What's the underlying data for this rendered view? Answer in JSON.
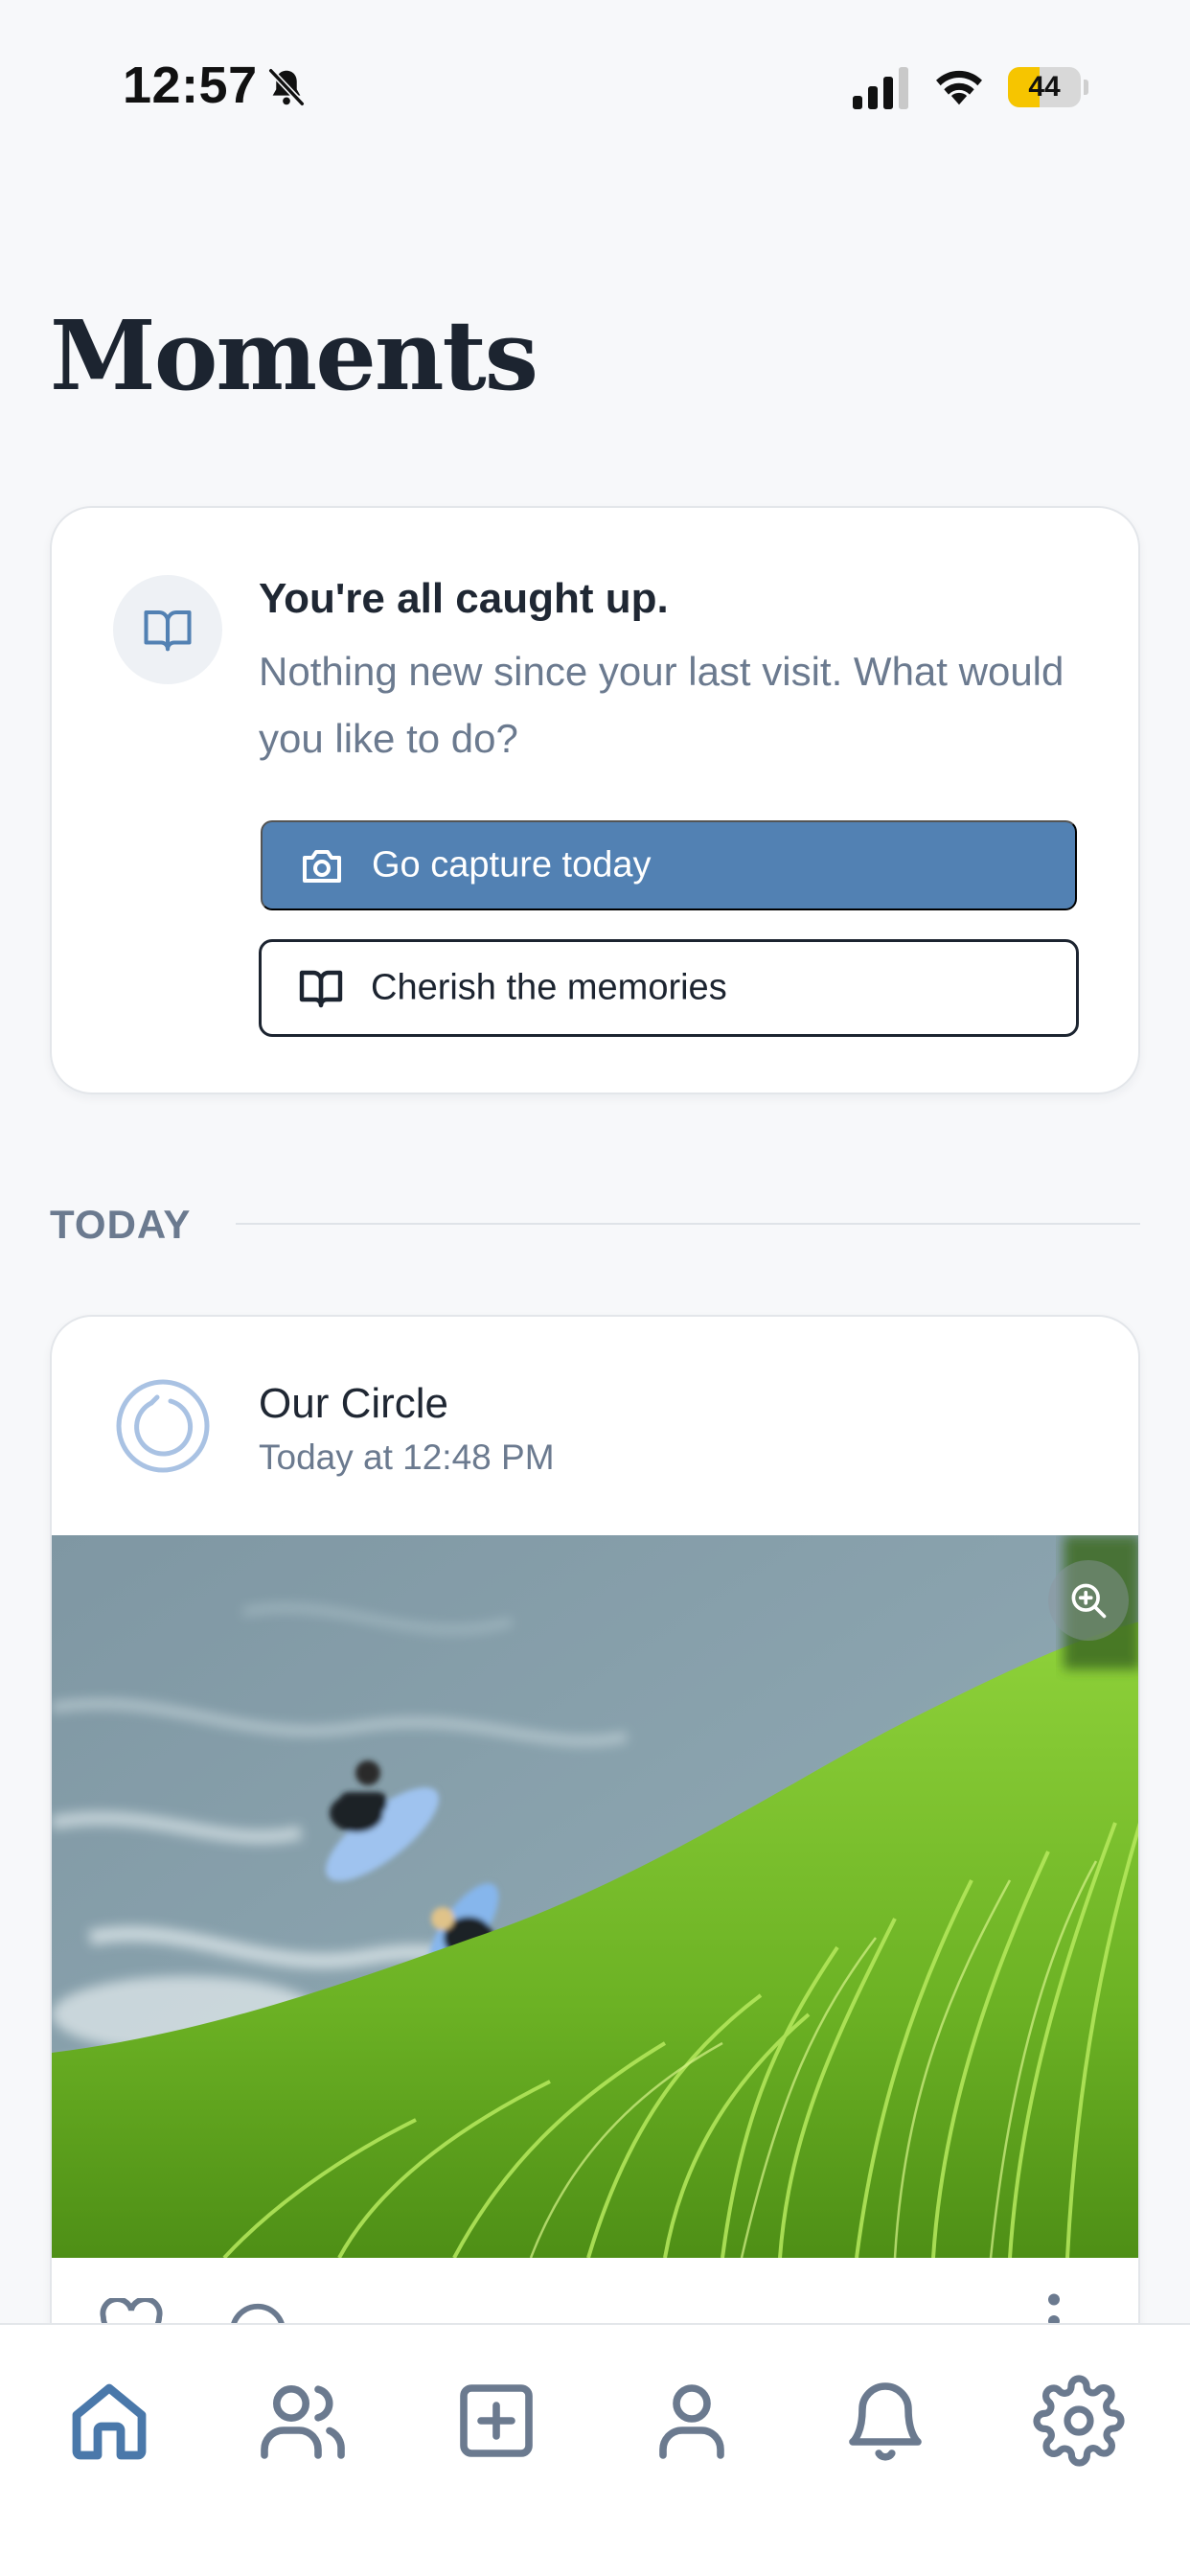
{
  "status_bar": {
    "time": "12:57",
    "battery_level": "44",
    "battery_fraction": 0.44
  },
  "page": {
    "title": "Moments"
  },
  "caught_up": {
    "icon": "book-open-icon",
    "title": "You're all caught up.",
    "description": "Nothing new since your last visit. What would you like to do?",
    "primary_button": {
      "label": "Go capture today",
      "icon": "camera-icon"
    },
    "secondary_button": {
      "label": "Cherish the memories",
      "icon": "book-open-icon"
    }
  },
  "section": {
    "label": "TODAY"
  },
  "post": {
    "author": "Our Circle",
    "timestamp": "Today at 12:48 PM",
    "image_description_icon": "photo",
    "zoom_icon": "zoom-in-icon"
  },
  "bottom_nav": {
    "items": [
      {
        "name": "home",
        "icon": "home-icon",
        "active": true
      },
      {
        "name": "circles",
        "icon": "users-icon",
        "active": false
      },
      {
        "name": "create",
        "icon": "plus-square-icon",
        "active": false
      },
      {
        "name": "profile",
        "icon": "user-icon",
        "active": false
      },
      {
        "name": "notifications",
        "icon": "bell-icon",
        "active": false
      },
      {
        "name": "settings",
        "icon": "gear-icon",
        "active": false
      }
    ]
  },
  "colors": {
    "accent": "#5281b3",
    "nav_active": "#4a78aa",
    "nav_inactive": "#6b7a8f",
    "title_text": "#1c2430",
    "muted_text": "#6b7a8f"
  }
}
